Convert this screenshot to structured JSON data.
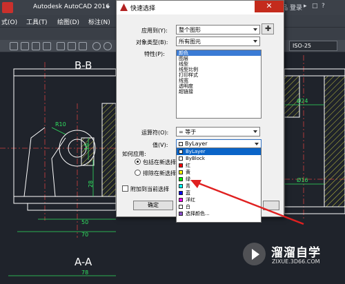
{
  "app": {
    "title": "Autodesk AutoCAD 2016",
    "title_extra": "▸",
    "right_items": [
      "品",
      "登录",
      "▸",
      "□",
      "?",
      "−",
      "□",
      "✕"
    ]
  },
  "menubar": {
    "items": [
      "式(O)",
      "工具(T)",
      "绘图(D)",
      "标注(N)"
    ]
  },
  "toolbar": {
    "iso_value": "ISO-25"
  },
  "drawing": {
    "view_top_label": "B-B",
    "view_bottom_label": "A-A",
    "dims": [
      "R10",
      "16",
      "28",
      "50",
      "70",
      "Ø24",
      "Ø16",
      "78"
    ]
  },
  "dialog": {
    "title": "快速选择",
    "close_glyph": "✕",
    "apply_to_label": "应用到(Y):",
    "apply_to_value": "整个图形",
    "object_type_label": "对象类型(B):",
    "object_type_value": "所有图元",
    "properties_label": "特性(P):",
    "properties": [
      "颜色",
      "图层",
      "线型",
      "线型比例",
      "打印样式",
      "线宽",
      "透明度",
      "超链接"
    ],
    "operator_label": "运算符(O):",
    "operator_value": "= 等于",
    "value_label": "值(V):",
    "value_value": "ByLayer",
    "how_apply_label": "如何应用:",
    "include_label": "包括在新选择",
    "exclude_label": "排除在新选择",
    "append_label": "附加到当前选择",
    "ok_label": "确定",
    "pick_glyph": "✚"
  },
  "value_dropdown": {
    "options": [
      {
        "label": "ByLayer",
        "color": "#ffffff"
      },
      {
        "label": "ByBlock",
        "color": "#ffffff"
      },
      {
        "label": "红",
        "color": "#ff0000"
      },
      {
        "label": "黄",
        "color": "#ffff00"
      },
      {
        "label": "绿",
        "color": "#00ff00"
      },
      {
        "label": "青",
        "color": "#00ffff"
      },
      {
        "label": "蓝",
        "color": "#0000ff"
      },
      {
        "label": "洋红",
        "color": "#ff00ff"
      },
      {
        "label": "白",
        "color": "#ffffff"
      },
      {
        "label": "选择颜色...",
        "color": "#8a4fc8"
      }
    ]
  },
  "watermark": {
    "title": "溜溜自学",
    "subtitle": "ZIXUE.3D66.COM"
  }
}
